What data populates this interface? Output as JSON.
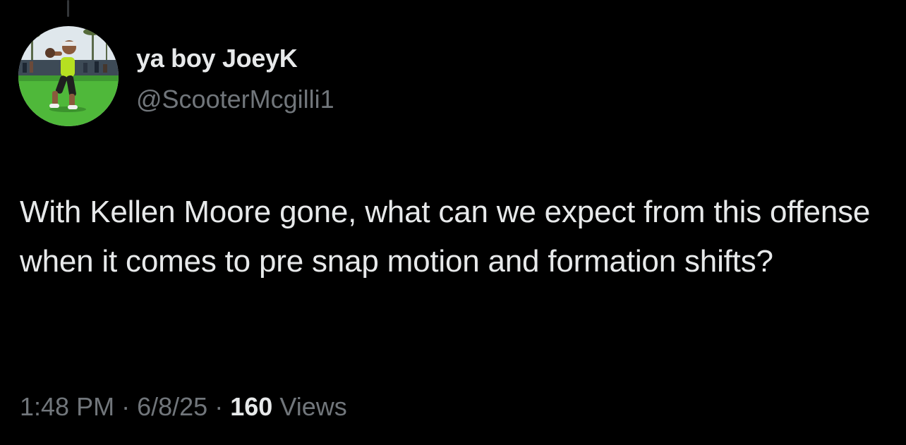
{
  "author": {
    "display_name": "ya boy JoeyK",
    "handle": "@ScooterMcgilli1"
  },
  "tweet": {
    "text": "With Kellen Moore gone, what can we expect from this offense when it comes to pre snap motion and formation shifts?"
  },
  "meta": {
    "time": "1:48 PM",
    "separator": "·",
    "date": "6/8/25",
    "views_count": "160",
    "views_label": "Views"
  },
  "colors": {
    "background": "#000000",
    "primary_text": "#e7e9ea",
    "secondary_text": "#71767b"
  }
}
